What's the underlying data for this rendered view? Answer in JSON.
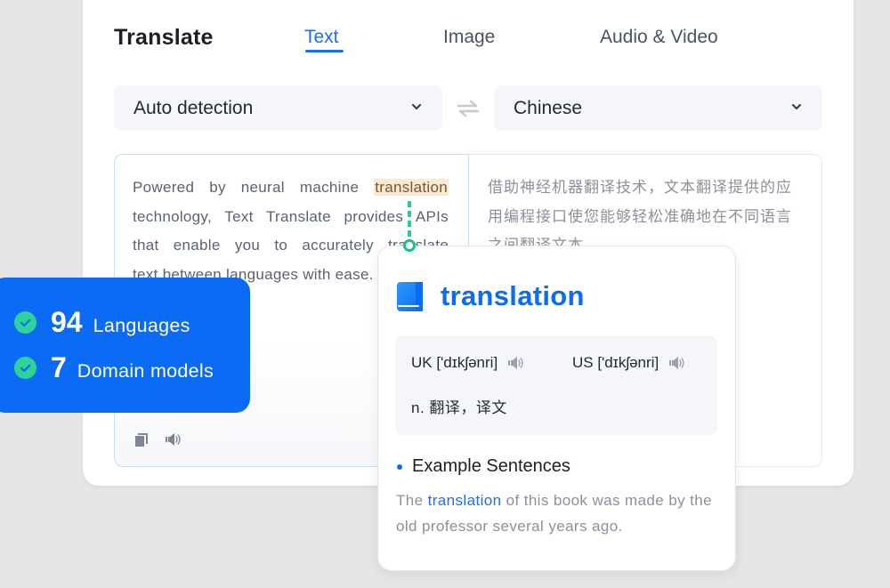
{
  "app": {
    "title": "Translate",
    "tabs": [
      {
        "label": "Text",
        "active": true
      },
      {
        "label": "Image",
        "active": false
      },
      {
        "label": "Audio & Video",
        "active": false
      }
    ]
  },
  "language_bar": {
    "source_language": "Auto detection",
    "target_language": "Chinese",
    "swap_icon": "swap-arrows-icon"
  },
  "source": {
    "text_before": "Powered by neural machine ",
    "highlighted_word": "translation",
    "line2": "technology, Text Translate provides APIs",
    "line3": "that enable you to accurately translate",
    "line4": "text between languages with ease.",
    "tools": [
      "copy-icon",
      "speaker-icon"
    ]
  },
  "target": {
    "text": "借助神经机器翻译技术，文本翻译提供的应用编程接口使您能够轻松准确地在不同语言之间翻译文本。"
  },
  "stats": [
    {
      "number": "94",
      "label": "Languages",
      "icon": "check-circle-icon"
    },
    {
      "number": "7",
      "label": "Domain models",
      "icon": "check-circle-icon"
    }
  ],
  "dictionary": {
    "icon": "book-icon",
    "word": "translation",
    "uk_pron": "UK ['dɪkʃənri]",
    "us_pron": "US ['dɪkʃənri]",
    "meaning": "n. 翻译，译文",
    "example_heading": "Example Sentences",
    "example_before": "The ",
    "example_keyword": "translation",
    "example_after": " of this book was made by the old professor several years ago."
  },
  "colors": {
    "accent": "#1a6ef5",
    "stats_bg": "#0b6bf5",
    "check_green": "#2ed39a",
    "highlight": "#fde9cd",
    "connector": "#17c37b"
  }
}
